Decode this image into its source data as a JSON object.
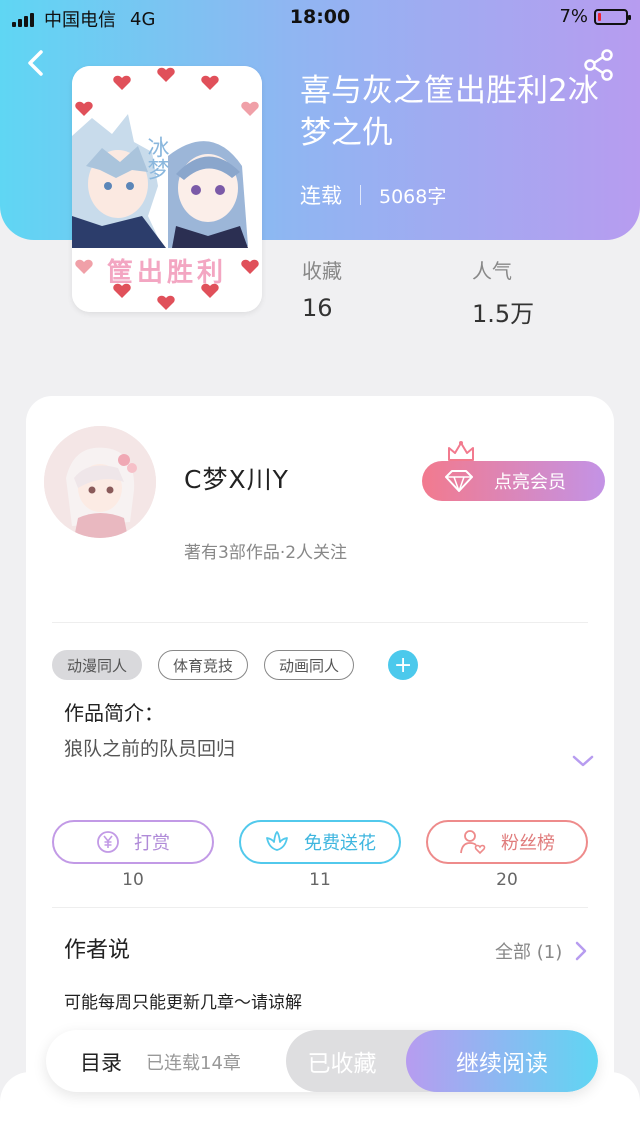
{
  "status_bar": {
    "carrier": "中国电信",
    "network": "4G",
    "time": "18:00",
    "battery": "7%"
  },
  "book": {
    "title": "喜与灰之筐出胜利2冰梦之仇",
    "status": "连载",
    "word_count": "5068字",
    "cover_text": "筐出胜利",
    "favorites_label": "收藏",
    "favorites_value": "16",
    "popularity_label": "人气",
    "popularity_value": "1.5万"
  },
  "author": {
    "name": "C梦X川Y",
    "summary": "著有3部作品·2人关注",
    "vip_button": "点亮会员"
  },
  "tags": [
    "动漫同人",
    "体育竞技",
    "动画同人"
  ],
  "intro": {
    "label": "作品简介：",
    "text": "狼队之前的队员回归"
  },
  "actions": {
    "reward_label": "打赏",
    "reward_count": "10",
    "flower_label": "免费送花",
    "flower_count": "11",
    "fans_label": "粉丝榜",
    "fans_count": "20"
  },
  "author_says": {
    "label": "作者说",
    "all_label": "全部 (1)",
    "text": "可能每周只能更新几章～请谅解"
  },
  "bottom_bar": {
    "toc": "目录",
    "chapters": "已连载14章",
    "favorited": "已收藏",
    "continue": "继续阅读"
  },
  "colors": {
    "gradient_start": "#5fd6f3",
    "gradient_end": "#b79cf0",
    "vip_start": "#f27a8e",
    "vip_end": "#c393e6",
    "reward": "#c29ae6",
    "flower": "#52c9ec",
    "fans": "#ee8b8b"
  },
  "icons": [
    "back-icon",
    "share-icon",
    "crown-icon",
    "diamond-icon",
    "plus-icon",
    "chevron-down-icon",
    "yen-icon",
    "flower-icon",
    "user-heart-icon",
    "chevron-right-icon"
  ]
}
